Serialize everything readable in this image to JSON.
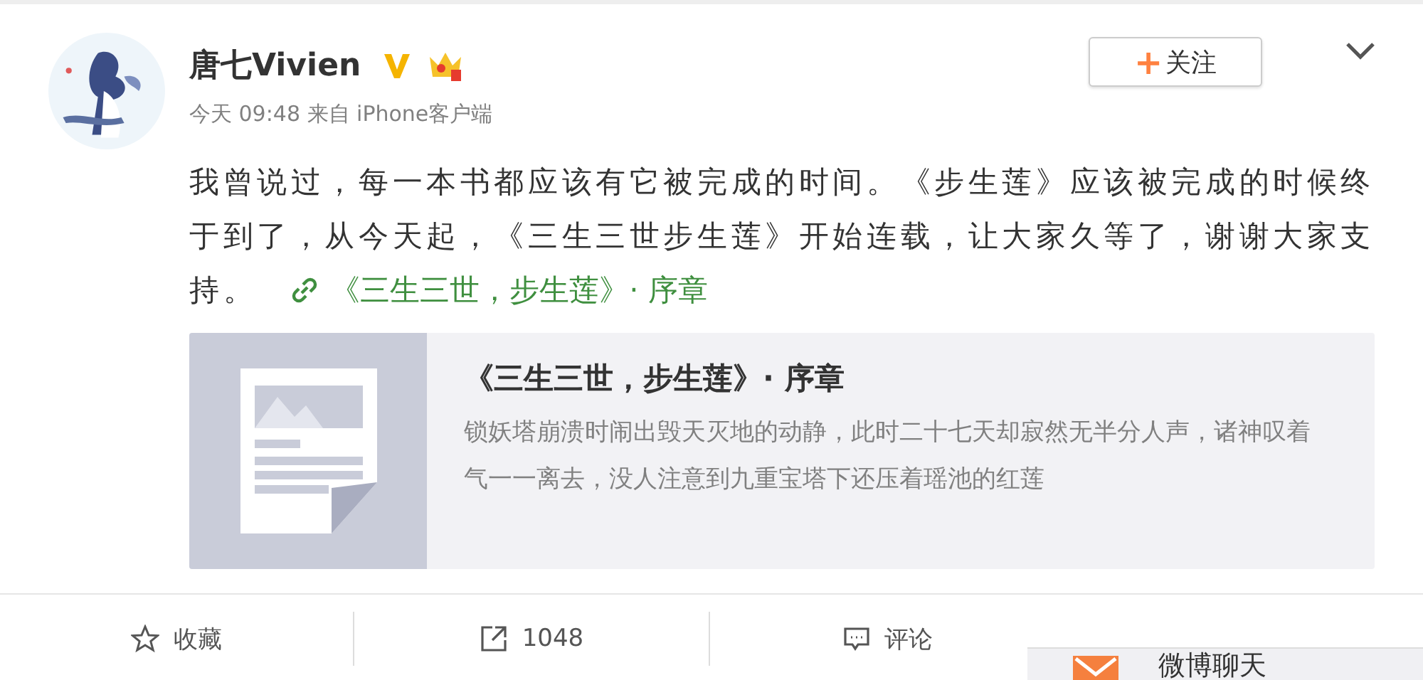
{
  "post": {
    "author": "唐七Vivien",
    "meta": "今天 09:48 来自 iPhone客户端",
    "follow": {
      "icon": "+",
      "label": "关注"
    },
    "text": "我曾说过，每一本书都应该有它被完成的时间。《步生莲》应该被完成的时候终于到了，从今天起，《三生三世步生莲》开始连载，让大家久等了，谢谢大家支持。",
    "link": "《三生三世，步生莲》· 序章",
    "card": {
      "title": "《三生三世，步生莲》· 序章",
      "description": "锁妖塔崩溃时闹出毁天灭地的动静，此时二十七天却寂然无半分人声，诸神叹着气一一离去，没人注意到九重宝塔下还压着瑶池的红莲"
    }
  },
  "actions": [
    {
      "kind": "favorite",
      "label": "收藏"
    },
    {
      "kind": "share",
      "label": "1048"
    },
    {
      "kind": "comment",
      "label": "评论"
    }
  ],
  "chat": {
    "label": "微博聊天"
  }
}
